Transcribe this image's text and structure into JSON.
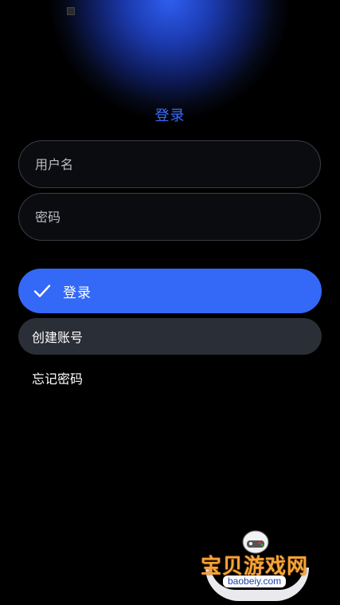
{
  "header": {
    "title": "登录"
  },
  "form": {
    "username_placeholder": "用户名",
    "password_placeholder": "密码"
  },
  "actions": {
    "login_label": "登录",
    "create_account_label": "创建账号",
    "forgot_password_label": "忘记密码"
  },
  "watermark": {
    "text": "宝贝游戏网",
    "sub": "baobeiy.com"
  },
  "colors": {
    "accent": "#3468f7",
    "title": "#3b6cff",
    "secondary_button": "#2a2e37",
    "background": "#000000"
  }
}
